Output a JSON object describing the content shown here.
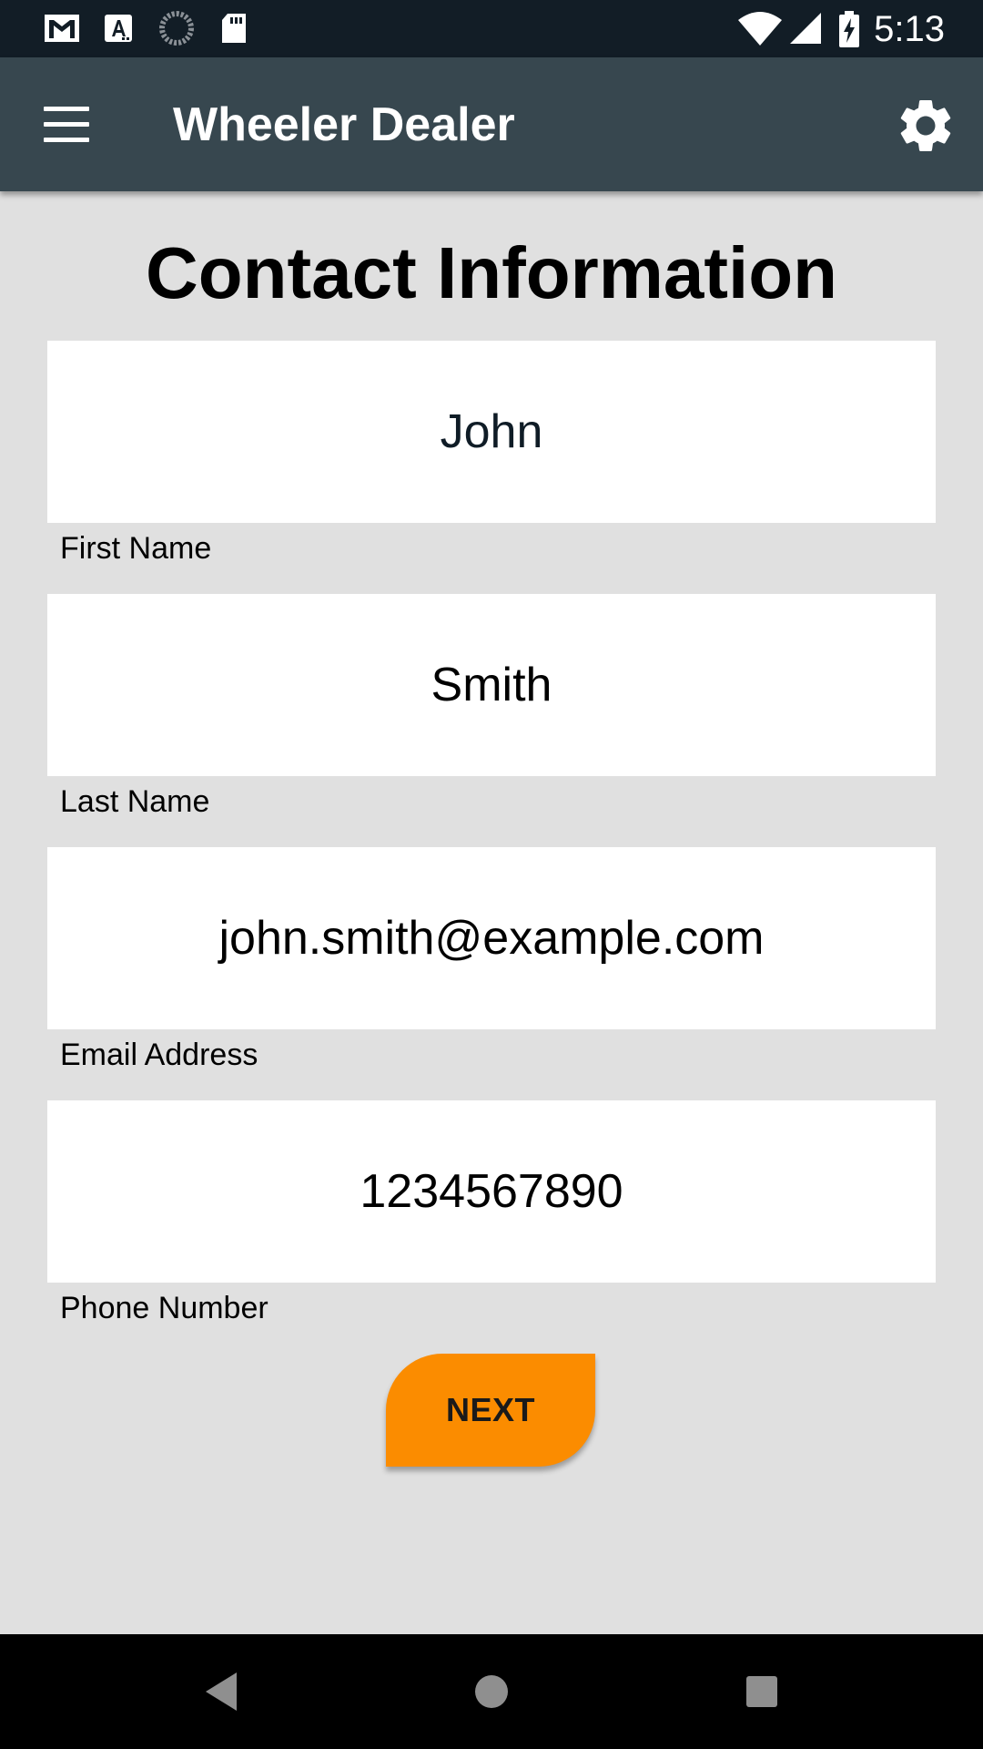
{
  "status_bar": {
    "time": "5:13",
    "left_icons": [
      "gmail-icon",
      "font-a-icon",
      "sync-progress-icon",
      "sd-card-icon"
    ],
    "right_icons": [
      "wifi-icon",
      "cell-signal-icon",
      "battery-charging-icon"
    ]
  },
  "app_bar": {
    "title": "Wheeler Dealer",
    "menu_icon": "hamburger-menu-icon",
    "settings_icon": "gear-icon"
  },
  "page": {
    "title": "Contact Information"
  },
  "form": {
    "first_name": {
      "value": "John",
      "label": "First Name"
    },
    "last_name": {
      "value": "Smith",
      "label": "Last Name"
    },
    "email": {
      "value": "john.smith@example.com",
      "label": "Email Address"
    },
    "phone": {
      "value": "1234567890",
      "label": "Phone Number"
    }
  },
  "next_button": {
    "label": "NEXT",
    "color": "#fb8c00"
  },
  "nav_bar": {
    "icons": [
      "back-icon",
      "home-icon",
      "recents-icon"
    ]
  },
  "colors": {
    "status_bar": "#121d26",
    "app_bar": "#37474f",
    "background": "#e0e0e0",
    "field_background": "#ffffff"
  }
}
